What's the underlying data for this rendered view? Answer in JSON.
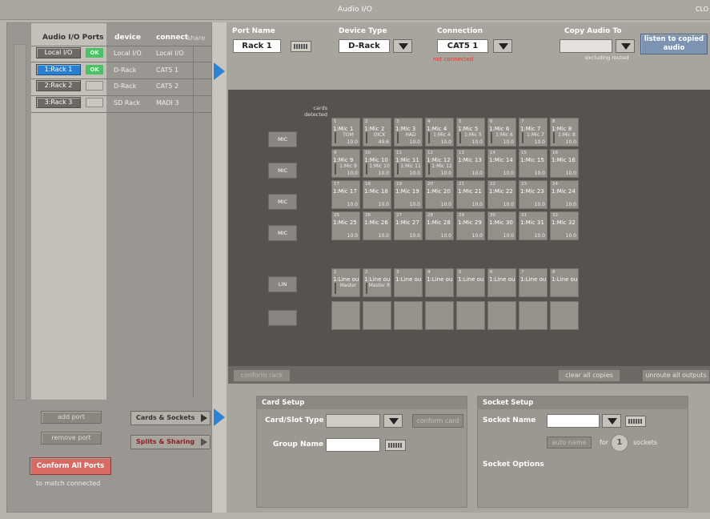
{
  "window": {
    "title": "Audio I/O",
    "close_label": "CLO"
  },
  "ports_header": {
    "col1": "Audio I/O Ports",
    "col2": "device",
    "col3": "connect",
    "col4": "share"
  },
  "ports": [
    {
      "name": "Local I/O",
      "status": "OK",
      "device": "Local I/O",
      "connect": "Local I/O"
    },
    {
      "name": "1:Rack 1",
      "status": "OK",
      "device": "D-Rack",
      "connect": "CAT5 1"
    },
    {
      "name": "2:Rack 2",
      "status": "",
      "device": "D-Rack",
      "connect": "CAT5 2"
    },
    {
      "name": "3:Rack 3",
      "status": "",
      "device": "SD Rack",
      "connect": "MADI 3"
    }
  ],
  "left_buttons": {
    "add_port": "add port",
    "remove_port": "remove port",
    "cards_sockets": "Cards & Sockets",
    "splits_sharing": "Splits & Sharing",
    "conform_all": "Conform All Ports",
    "conform_note": "to match connected"
  },
  "port_settings": {
    "port_name_label": "Port Name",
    "port_name_value": "Rack 1",
    "device_type_label": "Device Type",
    "device_type_value": "D-Rack",
    "connection_label": "Connection",
    "connection_value": "CAT5 1",
    "connection_status": "not connected",
    "copy_audio_label": "Copy Audio To",
    "copy_audio_note": "excluding routed",
    "listen_label": "listen to copied audio"
  },
  "cards_detected": "cards detected",
  "card_types": [
    "MIC",
    "MIC",
    "MIC",
    "MIC",
    "LIN",
    ""
  ],
  "mic_rows": [
    [
      {
        "n": "1",
        "name": "1:Mic 1",
        "sub": "TOM",
        "g": "10.0"
      },
      {
        "n": "2",
        "name": "1:Mic 2",
        "sub": "OICK",
        "g": "49.6"
      },
      {
        "n": "3",
        "name": "1:Mic 3",
        "sub": "HAD",
        "g": "10.0"
      },
      {
        "n": "4",
        "name": "1:Mic 4",
        "sub": "1:Mic 4",
        "g": "10.0"
      },
      {
        "n": "5",
        "name": "1:Mic 5",
        "sub": "1:Mic 5",
        "g": "10.0"
      },
      {
        "n": "6",
        "name": "1:Mic 6",
        "sub": "1:Mic 6",
        "g": "10.0"
      },
      {
        "n": "7",
        "name": "1:Mic 7",
        "sub": "1:Mic 7",
        "g": "10.0"
      },
      {
        "n": "8",
        "name": "1:Mic 8",
        "sub": "1:Mic 8",
        "g": "10.0"
      }
    ],
    [
      {
        "n": "9",
        "name": "1:Mic 9",
        "sub": "1:Mic 9",
        "g": "10.0"
      },
      {
        "n": "10",
        "name": "1:Mic 10",
        "sub": "1:Mic 10",
        "g": "10.0"
      },
      {
        "n": "11",
        "name": "1:Mic 11",
        "sub": "1:Mic 11",
        "g": "10.0"
      },
      {
        "n": "12",
        "name": "1:Mic 12",
        "sub": "1:Mic 12",
        "g": "10.0"
      },
      {
        "n": "13",
        "name": "1:Mic 13",
        "sub": "",
        "g": "10.0"
      },
      {
        "n": "14",
        "name": "1:Mic 14",
        "sub": "",
        "g": "10.0"
      },
      {
        "n": "15",
        "name": "1:Mic 15",
        "sub": "",
        "g": "10.0"
      },
      {
        "n": "16",
        "name": "1:Mic 16",
        "sub": "",
        "g": "10.0"
      }
    ],
    [
      {
        "n": "17",
        "name": "1:Mic 17",
        "sub": "",
        "g": "10.0"
      },
      {
        "n": "18",
        "name": "1:Mic 18",
        "sub": "",
        "g": "10.0"
      },
      {
        "n": "19",
        "name": "1:Mic 19",
        "sub": "",
        "g": "10.0"
      },
      {
        "n": "20",
        "name": "1:Mic 20",
        "sub": "",
        "g": "10.0"
      },
      {
        "n": "21",
        "name": "1:Mic 21",
        "sub": "",
        "g": "10.0"
      },
      {
        "n": "22",
        "name": "1:Mic 22",
        "sub": "",
        "g": "10.0"
      },
      {
        "n": "23",
        "name": "1:Mic 23",
        "sub": "",
        "g": "10.0"
      },
      {
        "n": "24",
        "name": "1:Mic 24",
        "sub": "",
        "g": "10.0"
      }
    ],
    [
      {
        "n": "25",
        "name": "1:Mic 25",
        "sub": "",
        "g": "10.0"
      },
      {
        "n": "26",
        "name": "1:Mic 26",
        "sub": "",
        "g": "10.0"
      },
      {
        "n": "27",
        "name": "1:Mic 27",
        "sub": "",
        "g": "10.0"
      },
      {
        "n": "28",
        "name": "1:Mic 28",
        "sub": "",
        "g": "10.0"
      },
      {
        "n": "29",
        "name": "1:Mic 29",
        "sub": "",
        "g": "10.0"
      },
      {
        "n": "30",
        "name": "1:Mic 30",
        "sub": "",
        "g": "10.0"
      },
      {
        "n": "31",
        "name": "1:Mic 31",
        "sub": "",
        "g": "10.0"
      },
      {
        "n": "32",
        "name": "1:Mic 32",
        "sub": "",
        "g": "10.0"
      }
    ]
  ],
  "line_row": [
    {
      "n": "1",
      "name": "1:Line ou",
      "sub": "Master"
    },
    {
      "n": "2",
      "name": "1:Line ou",
      "sub": "Master R"
    },
    {
      "n": "3",
      "name": "1:Line ou",
      "sub": ""
    },
    {
      "n": "4",
      "name": "1:Line ou",
      "sub": ""
    },
    {
      "n": "5",
      "name": "1:Line ou",
      "sub": ""
    },
    {
      "n": "6",
      "name": "1:Line ou",
      "sub": ""
    },
    {
      "n": "7",
      "name": "1:Line ou",
      "sub": ""
    },
    {
      "n": "8",
      "name": "1:Line ou",
      "sub": ""
    }
  ],
  "actions": {
    "conform_rack": "conform rack",
    "clear_copies": "clear all copies",
    "unroute_outputs": "unroute all outputs"
  },
  "card_setup": {
    "title": "Card Setup",
    "slot_type_label": "Card/Slot Type",
    "conform_card": "conform card",
    "group_name_label": "Group Name"
  },
  "socket_setup": {
    "title": "Socket Setup",
    "socket_name_label": "Socket Name",
    "auto_name": "auto name",
    "for_label": "for",
    "count": "1",
    "sockets_label": "sockets",
    "options_label": "Socket Options"
  },
  "colors": {
    "selected": "#2a7fd1",
    "ok": "#4ec06a",
    "stage": "#56524e",
    "warning": "#e03a2a"
  }
}
